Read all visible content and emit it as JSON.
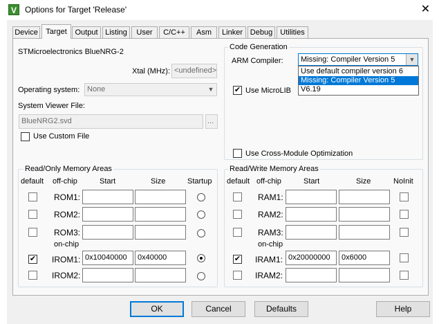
{
  "window": {
    "title": "Options for Target 'Release'",
    "close_glyph": "✕",
    "icon_letter": "V"
  },
  "tabs": [
    {
      "label": "Device"
    },
    {
      "label": "Target"
    },
    {
      "label": "Output"
    },
    {
      "label": "Listing"
    },
    {
      "label": "User"
    },
    {
      "label": "C/C++"
    },
    {
      "label": "Asm"
    },
    {
      "label": "Linker"
    },
    {
      "label": "Debug"
    },
    {
      "label": "Utilities"
    }
  ],
  "target": {
    "device_name": "STMicroelectronics BlueNRG-2",
    "xtal_label": "Xtal (MHz):",
    "xtal_value": "<undefined>",
    "os_label": "Operating system:",
    "os_value": "None",
    "svf_label": "System Viewer File:",
    "svf_value": "BlueNRG2.svd",
    "svf_browse": "...",
    "custom_file_label": "Use Custom File"
  },
  "code_generation": {
    "legend": "Code Generation",
    "arm_compiler_label": "ARM Compiler:",
    "arm_compiler_value": "Missing: Compiler Version 5",
    "dropdown_options": [
      {
        "label": "Use default compiler version 6",
        "selected": false
      },
      {
        "label": "Missing: Compiler Version 5",
        "selected": true
      },
      {
        "label": "V6.19",
        "selected": false
      }
    ],
    "microlib_label": "Use MicroLIB",
    "microlib_checked": true,
    "cross_module_label": "Use Cross-Module Optimization",
    "cross_module_checked": false
  },
  "rom_areas": {
    "legend": "Read/Only Memory Areas",
    "headers": {
      "default": "default",
      "offchip": "off-chip",
      "start": "Start",
      "size": "Size",
      "startup": "Startup"
    },
    "onchip_label": "on-chip",
    "rows": [
      {
        "name": "ROM1:",
        "start": "",
        "size": "",
        "default": false,
        "startup": false
      },
      {
        "name": "ROM2:",
        "start": "",
        "size": "",
        "default": false,
        "startup": false
      },
      {
        "name": "ROM3:",
        "start": "",
        "size": "",
        "default": false,
        "startup": false
      },
      {
        "name": "IROM1:",
        "start": "0x10040000",
        "size": "0x40000",
        "default": true,
        "startup": true
      },
      {
        "name": "IROM2:",
        "start": "",
        "size": "",
        "default": false,
        "startup": false
      }
    ]
  },
  "ram_areas": {
    "legend": "Read/Write Memory Areas",
    "headers": {
      "default": "default",
      "offchip": "off-chip",
      "start": "Start",
      "size": "Size",
      "noinit": "NoInit"
    },
    "onchip_label": "on-chip",
    "rows": [
      {
        "name": "RAM1:",
        "start": "",
        "size": "",
        "default": false,
        "noinit": false
      },
      {
        "name": "RAM2:",
        "start": "",
        "size": "",
        "default": false,
        "noinit": false
      },
      {
        "name": "RAM3:",
        "start": "",
        "size": "",
        "default": false,
        "noinit": false
      },
      {
        "name": "IRAM1:",
        "start": "0x20000000",
        "size": "0x6000",
        "default": true,
        "noinit": false
      },
      {
        "name": "IRAM2:",
        "start": "",
        "size": "",
        "default": false,
        "noinit": false
      }
    ]
  },
  "buttons": {
    "ok": "OK",
    "cancel": "Cancel",
    "defaults": "Defaults",
    "help": "Help"
  },
  "check_glyph": "✔",
  "icons": {
    "dropdown": "chevron-down-icon",
    "close": "close-icon",
    "app": "keil-uvision-icon"
  }
}
